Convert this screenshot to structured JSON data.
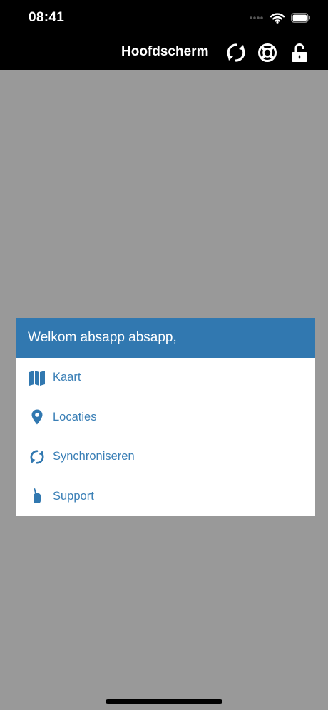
{
  "status_bar": {
    "time": "08:41"
  },
  "header": {
    "title": "Hoofdscherm",
    "actions": [
      {
        "icon": "sync-icon"
      },
      {
        "icon": "lifebuoy-icon"
      },
      {
        "icon": "unlock-icon"
      }
    ]
  },
  "dialog": {
    "greeting": "Welkom absapp absapp,",
    "items": [
      {
        "label": "Kaart",
        "icon": "map-icon"
      },
      {
        "label": "Locaties",
        "icon": "location-pin-icon"
      },
      {
        "label": "Synchroniseren",
        "icon": "sync-icon"
      },
      {
        "label": "Support",
        "icon": "phone-icon"
      }
    ]
  },
  "colors": {
    "overlay": "#999999",
    "header_background": "#000000",
    "dialog_header": "#3178b0",
    "link": "#3a7fb6"
  }
}
